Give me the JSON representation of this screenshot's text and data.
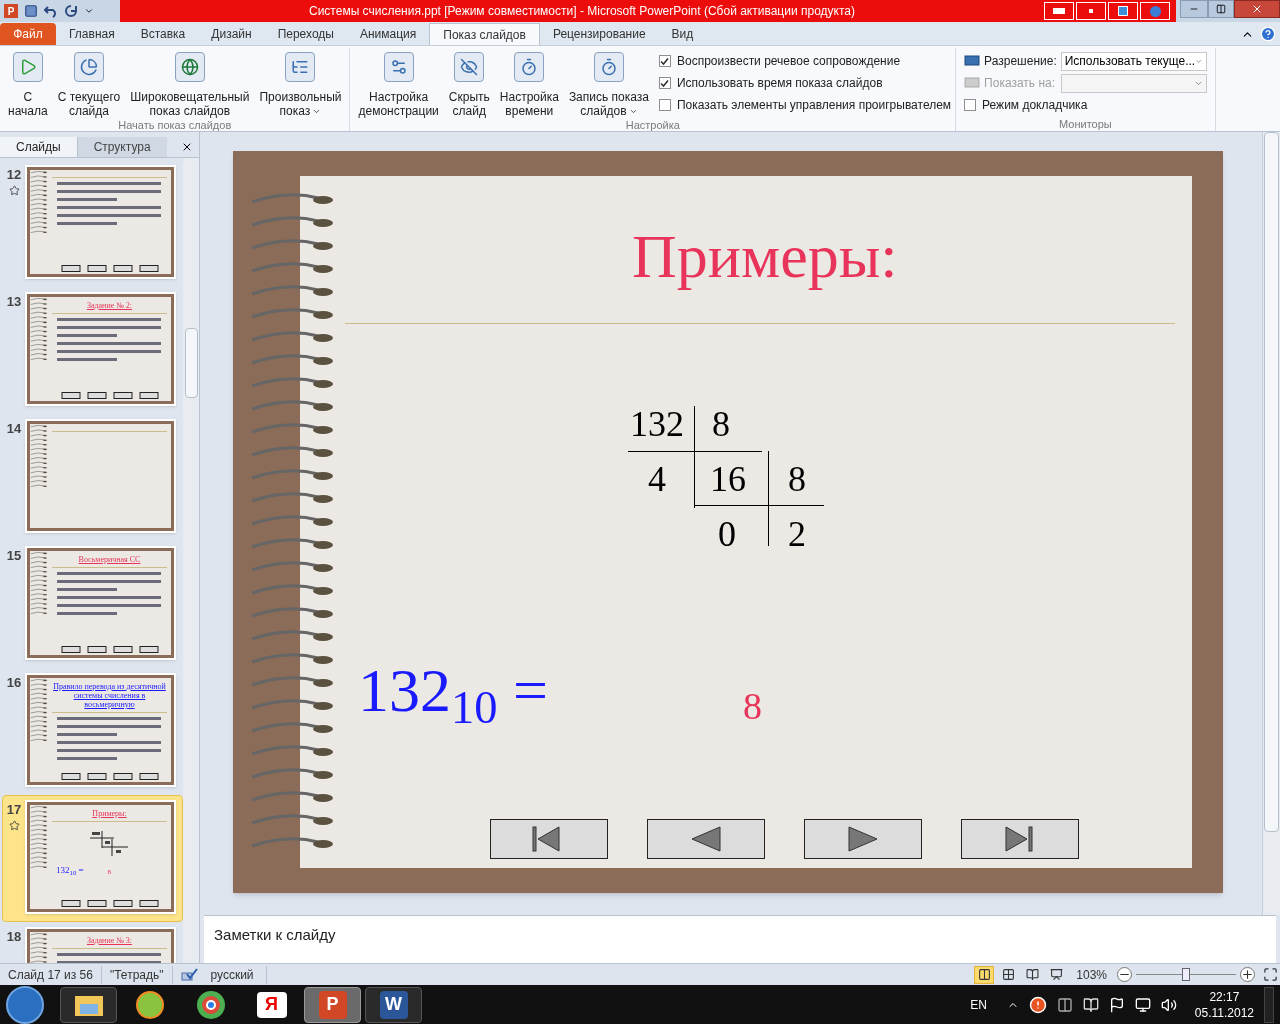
{
  "window": {
    "app_glyph": "P",
    "title": "Системы счисления.ppt [Режим совместимости] - Microsoft PowerPoint (Сбой активации продукта)"
  },
  "ribbon_tabs": [
    {
      "label": "Файл",
      "kind": "file",
      "selected": false
    },
    {
      "label": "Главная",
      "kind": "tab",
      "selected": false
    },
    {
      "label": "Вставка",
      "kind": "tab",
      "selected": false
    },
    {
      "label": "Дизайн",
      "kind": "tab",
      "selected": false
    },
    {
      "label": "Переходы",
      "kind": "tab",
      "selected": false
    },
    {
      "label": "Анимация",
      "kind": "tab",
      "selected": false
    },
    {
      "label": "Показ слайдов",
      "kind": "tab",
      "selected": true
    },
    {
      "label": "Рецензирование",
      "kind": "tab",
      "selected": false
    },
    {
      "label": "Вид",
      "kind": "tab",
      "selected": false
    }
  ],
  "ribbon_groups": [
    {
      "title": "Начать показ слайдов",
      "kind": "buttons",
      "buttons": [
        {
          "lines": [
            "С",
            "начала"
          ],
          "menu": false
        },
        {
          "lines": [
            "С текущего",
            "слайда"
          ],
          "menu": false
        },
        {
          "lines": [
            "Широковещательный",
            "показ слайдов"
          ],
          "menu": false
        },
        {
          "lines": [
            "Произвольный",
            "показ"
          ],
          "menu": true
        }
      ]
    },
    {
      "title": "Настройка",
      "kind": "setup",
      "buttons": [
        {
          "lines": [
            "Настройка",
            "демонстрации"
          ],
          "menu": false
        },
        {
          "lines": [
            "Скрыть",
            "слайд"
          ],
          "menu": false
        },
        {
          "lines": [
            "Настройка",
            "времени"
          ],
          "menu": false
        },
        {
          "lines": [
            "Запись показа",
            "слайдов"
          ],
          "menu": true
        }
      ],
      "checkboxes": [
        {
          "label": "Воспроизвести речевое сопровождение",
          "checked": true
        },
        {
          "label": "Использовать время показа слайдов",
          "checked": true
        },
        {
          "label": "Показать элементы управления проигрывателем",
          "checked": false
        }
      ]
    },
    {
      "title": "Мониторы",
      "kind": "monitors",
      "fields": [
        {
          "label": "Разрешение:",
          "value": "Использовать текуще...",
          "disabled": false
        },
        {
          "label": "Показать на:",
          "disabled": true
        }
      ],
      "checkboxes": [
        {
          "label": "Режим докладчика",
          "checked": false
        }
      ]
    }
  ],
  "left_panel": {
    "tabs": [
      {
        "label": "Слайды",
        "selected": true
      },
      {
        "label": "Структура",
        "selected": false
      }
    ],
    "thumbnails": [
      {
        "number": "12",
        "selected": false,
        "animated": true,
        "kind": "text"
      },
      {
        "number": "13",
        "selected": false,
        "animated": false,
        "kind": "text",
        "title": "Задание № 2:",
        "color": "#e8345a"
      },
      {
        "number": "14",
        "selected": false,
        "animated": false,
        "kind": "blank"
      },
      {
        "number": "15",
        "selected": false,
        "animated": false,
        "kind": "text",
        "title": "Восьмеричная СС",
        "color": "#e8345a"
      },
      {
        "number": "16",
        "selected": false,
        "animated": false,
        "kind": "text",
        "title": "Правило перевода из десятичной системы счисления в восьмеричную",
        "color": "#1a1aff"
      },
      {
        "number": "17",
        "selected": true,
        "animated": true,
        "kind": "examples",
        "title": "Примеры:",
        "color": "#e8345a",
        "formula": "132$_{10}$ =",
        "answer": "8"
      },
      {
        "number": "18",
        "selected": false,
        "animated": false,
        "kind": "text",
        "title": "Задание № 3:",
        "color": "#e8345a"
      }
    ]
  },
  "slide": {
    "title": "Примеры:",
    "division": [
      {
        "kind": "dividend",
        "text": "132"
      },
      {
        "kind": "divisor",
        "text": "8"
      },
      {
        "kind": "remainder1",
        "text": "4"
      },
      {
        "kind": "quotient1",
        "text": "16"
      },
      {
        "kind": "divisor2",
        "text": "8"
      },
      {
        "kind": "remainder2",
        "text": "0"
      },
      {
        "kind": "quotient2",
        "text": "2"
      }
    ],
    "formula": "132$_{10}$ =",
    "answer": "8",
    "nav_buttons": [
      {
        "kind": "first"
      },
      {
        "kind": "prev"
      },
      {
        "kind": "next"
      },
      {
        "kind": "last"
      }
    ]
  },
  "notes": {
    "placeholder": "Заметки к слайду"
  },
  "status_bar": {
    "slide_info": "Слайд 17 из 56",
    "theme": "\"Тетрадь\"",
    "language": "русский",
    "views": [
      {
        "kind": "normal",
        "selected": true
      },
      {
        "kind": "sorter",
        "selected": false
      },
      {
        "kind": "reading",
        "selected": false
      },
      {
        "kind": "show",
        "selected": false
      }
    ],
    "zoom": "103%",
    "zoom_level": {
      "level": 0.5
    }
  },
  "taskbar": {
    "apps": [
      {
        "kind": "explorer",
        "selected": false
      },
      {
        "kind": "ball",
        "selected": false
      },
      {
        "kind": "chrome",
        "selected": false
      },
      {
        "kind": "yandex",
        "glyph": "Я",
        "selected": false
      },
      {
        "kind": "powerpoint",
        "glyph": "P",
        "selected": true
      },
      {
        "kind": "word",
        "glyph": "W",
        "selected": false
      }
    ],
    "language": "EN",
    "time": "22:17",
    "date": "05.11.2012"
  }
}
